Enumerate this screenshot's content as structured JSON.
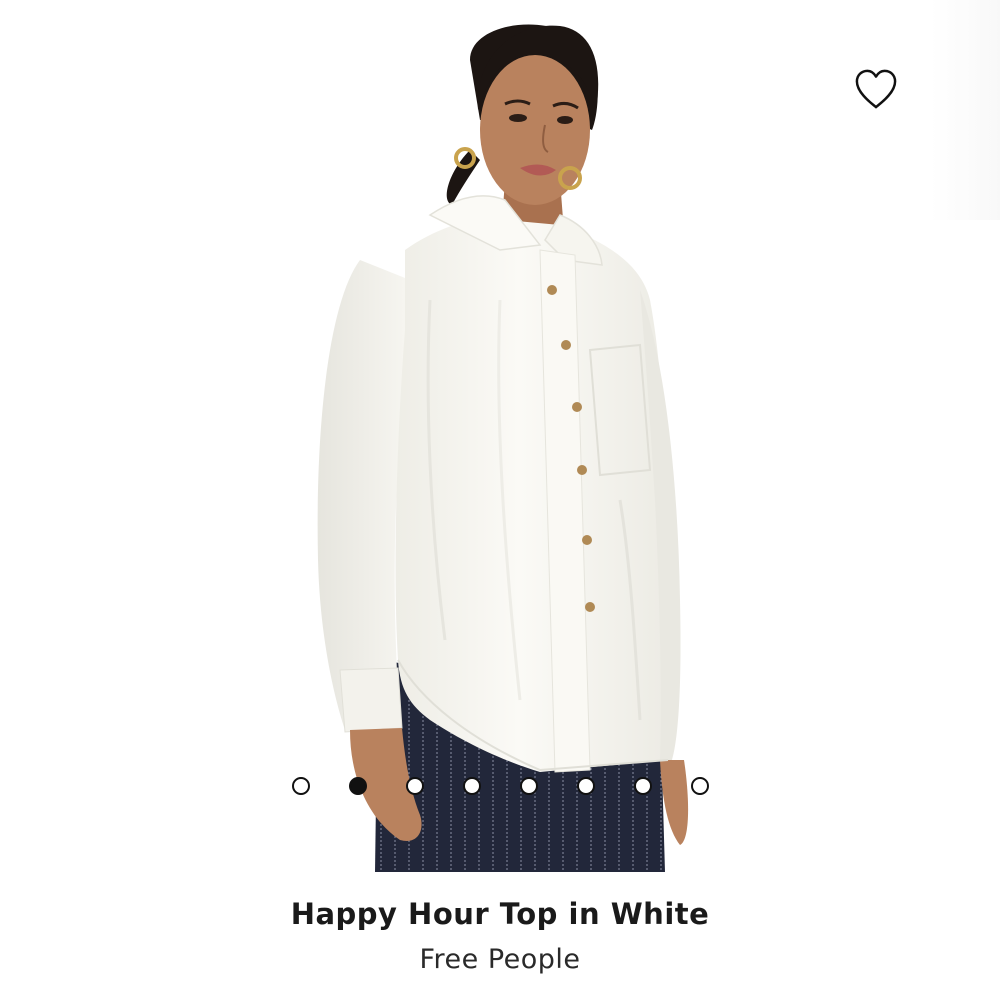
{
  "product": {
    "title": "Happy Hour Top in White",
    "brand": "Free People",
    "image": {
      "alt_semantic": "model-wearing-white-oversized-button-down-shirt"
    }
  },
  "wishlist": {
    "icon": "heart-outline-icon"
  },
  "carousel": {
    "total": 8,
    "active_index": 1
  },
  "colors": {
    "text": "#1a1a1a",
    "dot_border": "#111111",
    "shirt": "#f8f7f2",
    "trousers": "#22273a",
    "skin": "#b9825e",
    "hair": "#1c1512"
  }
}
